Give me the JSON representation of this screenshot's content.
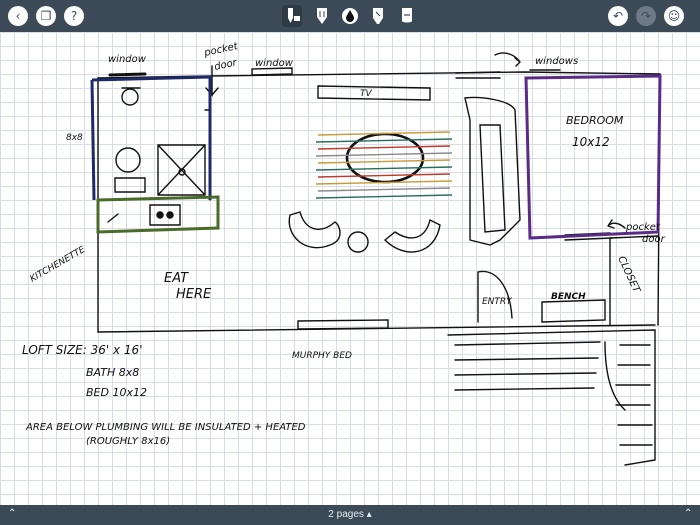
{
  "toolbar": {
    "left_buttons": [
      {
        "name": "back",
        "icon": "chevron-left-icon",
        "glyph": "‹"
      },
      {
        "name": "pages",
        "icon": "pages-icon",
        "glyph": "❐"
      },
      {
        "name": "help",
        "icon": "help-icon",
        "glyph": "?"
      }
    ],
    "tools": [
      {
        "name": "pencil",
        "icon": "pencil-camera-icon",
        "active": true
      },
      {
        "name": "pen",
        "icon": "pen-icon",
        "active": false
      },
      {
        "name": "ink",
        "icon": "ink-drop-icon",
        "active": false
      },
      {
        "name": "marker",
        "icon": "marker-icon",
        "active": false
      },
      {
        "name": "highlighter",
        "icon": "highlighter-icon",
        "active": false
      }
    ],
    "right_buttons": [
      {
        "name": "undo",
        "icon": "undo-icon",
        "glyph": "↶",
        "enabled": true
      },
      {
        "name": "redo",
        "icon": "redo-icon",
        "glyph": "↷",
        "enabled": false
      },
      {
        "name": "account",
        "icon": "user-badge-icon",
        "glyph": "☺",
        "enabled": true
      }
    ]
  },
  "sketch": {
    "labels": {
      "window1": "window",
      "pocket_door1": "pocket",
      "pocket_door1b": "door",
      "window2": "window",
      "windows": "windows",
      "bath_size": "8x8",
      "tv": "TV",
      "bedroom": "BEDROOM",
      "bedroom_size": "10x12",
      "pocket_door2": "pocket",
      "pocket_door2b": "door",
      "kitchenette": "KITCHENETTE",
      "eat": "EAT",
      "here": "HERE",
      "closet": "CLOSET",
      "bench": "BENCH",
      "entry": "ENTRY",
      "murphy_bed": "MURPHY BED",
      "loft_size": "LOFT  SIZE: 36' x 16'",
      "bath": "BATH   8x8",
      "bed": "BED    10x12",
      "note1": "AREA BELOW PLUMBING WILL BE INSULATED + HEATED",
      "note2": "(ROUGHLY  8x16)"
    },
    "stroke_colors": {
      "ink": "#111111",
      "bath_wall": "#1f2a6b",
      "kitchen_counter": "#4a6b2a",
      "bedroom_wall": "#5b2b8a",
      "rug": [
        "#c89a3a",
        "#2a6e5a",
        "#c0392b",
        "#8a8a8a"
      ]
    }
  },
  "footer": {
    "pages_label": "2 pages ▴",
    "left_arrow": "⌃",
    "right_arrow": "⌃"
  }
}
